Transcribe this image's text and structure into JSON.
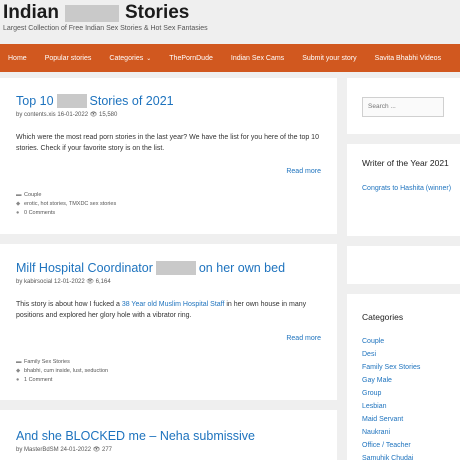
{
  "site": {
    "title_start": "Indian",
    "title_end": "Stories",
    "tagline": "Largest Collection of Free Indian Sex Stories & Hot Sex Fantasies"
  },
  "nav": [
    "Home",
    "Popular stories",
    "Categories",
    "ThePornDude",
    "Indian Sex Cams",
    "Submit your story",
    "Savita Bhabhi Videos"
  ],
  "posts": [
    {
      "title_start": "Top 10",
      "title_end": "Stories of 2021",
      "meta": "by contents.xis 16-01-2022 👁 15,580",
      "excerpt": "Which were the most read porn stories in the last year? We have the list for you here of the top 10 stories. Check if your favorite story is on the list.",
      "read_more": "Read more",
      "category": "Couple",
      "tags": "erotic, hot stories, TMXDC sex stories",
      "comments": "0 Comments"
    },
    {
      "title_start": "Milf Hospital Coordinator",
      "title_end": "on her own bed",
      "meta": "by kabirsocial 12-01-2022 👁 6,164",
      "excerpt_before": "This story is about how I fucked a ",
      "excerpt_link": "38 Year old Muslim Hospital Staff",
      "excerpt_after": " in her own house in many positions and explored her glory hole with a vibrator ring.",
      "read_more": "Read more",
      "category": "Family Sex Stories",
      "tags": "bhabhi, cum inside, lust, seduction",
      "comments": "1 Comment"
    },
    {
      "title": "And she BLOCKED me – Neha submissive",
      "meta": "by MasterBdSM 24-01-2022 👁 277"
    }
  ],
  "sidebar": {
    "search_placeholder": "Search ...",
    "writer_title": "Writer of the Year 2021",
    "writer_text": "Congrats to Hashita (winner)",
    "categories_title": "Categories",
    "categories": [
      "Couple",
      "Desi",
      "Family Sex Stories",
      "Gay Male",
      "Group",
      "Lesbian",
      "Maid Servant",
      "Naukrani",
      "Office / Teacher",
      "Samuhik Chudai"
    ]
  },
  "icons": {
    "category": "folder-icon",
    "tags": "tag-icon",
    "comments": "comment-icon",
    "dropdown": "chevron-down-icon"
  },
  "colors": {
    "nav_bg": "#d1581f",
    "link": "#1e73be",
    "page_bg": "#efefef"
  }
}
